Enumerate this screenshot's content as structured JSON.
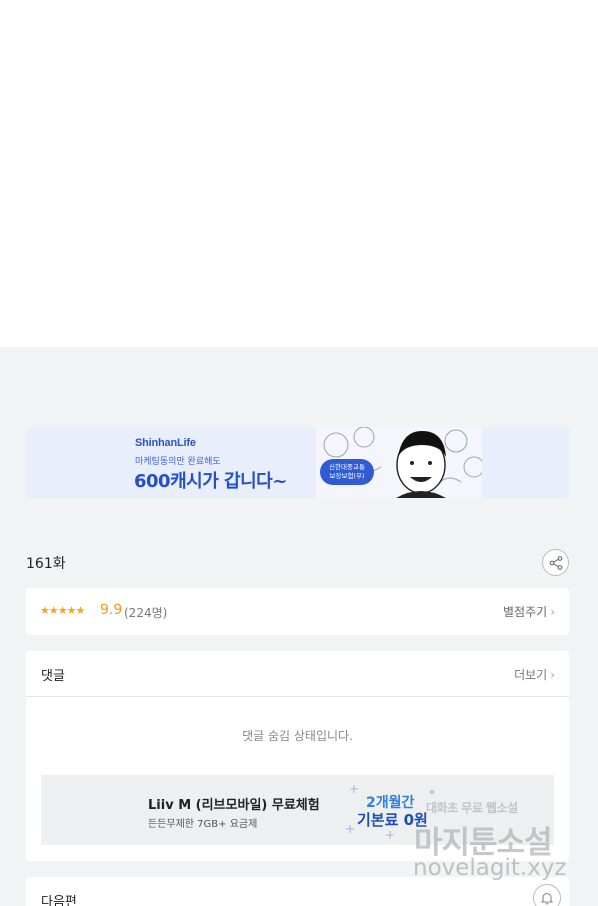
{
  "ad_banner": {
    "brand": "ShinhanLife",
    "subtitle": "마케팅동의만 완료해도",
    "headline": "600캐시가 갑니다~",
    "badge": "신한대중교통\n보장보험(무)"
  },
  "episode": {
    "title": "161화"
  },
  "rating": {
    "stars": "★★★★★",
    "score": "9.9",
    "votes": "(224명)",
    "rate_label": "별점주기"
  },
  "comments": {
    "title": "댓글",
    "more_label": "더보기",
    "hidden_message": "댓글 숨김 상태입니다."
  },
  "promo_banner": {
    "title": "Liiv M (리브모바일) 무료체험",
    "subtitle": "든든무제한 7GB+ 요금제",
    "promo_line1": "2개월간",
    "promo_line2": "기본료 0원"
  },
  "next": {
    "title": "다음편"
  },
  "watermark": {
    "top": "대화초 무료 웹소설",
    "main": "마지툰소설",
    "url": "novelagit.xyz"
  },
  "colors": {
    "gray_bg": "#f2f3f5",
    "accent_orange": "#f29b0a",
    "banner_blue": "#2450c8"
  }
}
